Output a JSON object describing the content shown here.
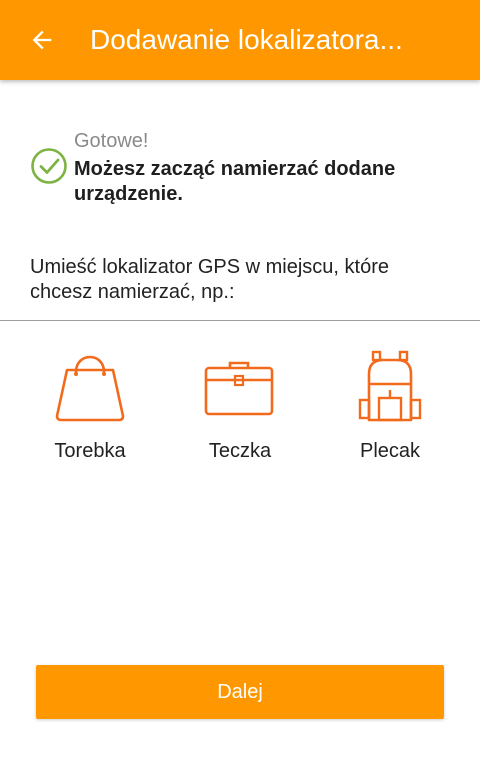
{
  "appbar": {
    "title": "Dodawanie lokalizatora...",
    "back_icon": "arrow-left-icon",
    "color": "#FF9800"
  },
  "status": {
    "icon": "check-circle-icon",
    "icon_color": "#7CB342",
    "label": "Gotowe!",
    "message": "Możesz zacząć namierzać dodane urządzenie."
  },
  "instruction": "Umieść lokalizator GPS w miejscu, które chcesz namierzać, np.:",
  "options": [
    {
      "label": "Torebka",
      "icon": "handbag-icon"
    },
    {
      "label": "Teczka",
      "icon": "briefcase-icon"
    },
    {
      "label": "Plecak",
      "icon": "backpack-icon"
    }
  ],
  "icon_color": "#F26B1D",
  "next_button": {
    "label": "Dalej",
    "color": "#FF9800"
  }
}
